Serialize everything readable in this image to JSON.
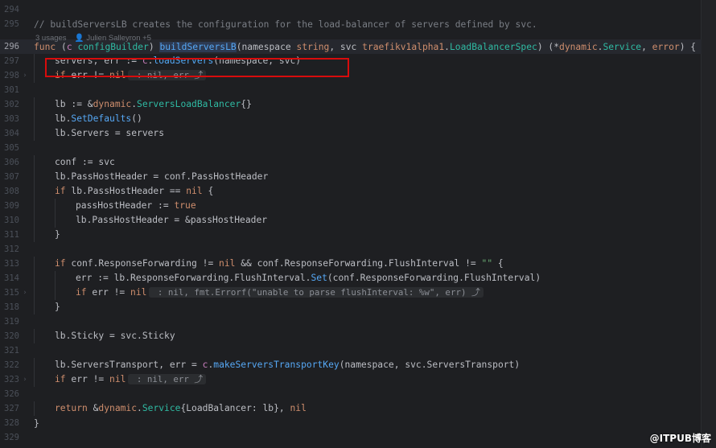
{
  "editor": {
    "usages_text": "3 usages",
    "author_text": "Julien Salleyron +5",
    "watermark": "@ITPUB博客"
  },
  "lines": [
    {
      "n": "294",
      "segments": []
    },
    {
      "n": "295",
      "segments": [
        {
          "t": "// buildServersLB creates the configuration for the load-balancer of servers defined by svc.",
          "c": "comment"
        }
      ]
    },
    {
      "n": "296",
      "current": true,
      "segments": [
        {
          "t": "func ",
          "c": "kw"
        },
        {
          "t": "(",
          "c": "plain"
        },
        {
          "t": "c ",
          "c": "param"
        },
        {
          "t": "configBuilder",
          "c": "type"
        },
        {
          "t": ") ",
          "c": "plain"
        },
        {
          "t": "buildServersLB",
          "c": "hl-fn"
        },
        {
          "t": "(namespace ",
          "c": "plain"
        },
        {
          "t": "string",
          "c": "kw"
        },
        {
          "t": ", svc ",
          "c": "plain"
        },
        {
          "t": "traefikv1alpha1",
          "c": "kw"
        },
        {
          "t": ".",
          "c": "plain"
        },
        {
          "t": "LoadBalancerSpec",
          "c": "type"
        },
        {
          "t": ") (*",
          "c": "plain"
        },
        {
          "t": "dynamic",
          "c": "kw"
        },
        {
          "t": ".",
          "c": "plain"
        },
        {
          "t": "Service",
          "c": "type"
        },
        {
          "t": ", ",
          "c": "plain"
        },
        {
          "t": "error",
          "c": "kw"
        },
        {
          "t": ") {",
          "c": "plain"
        }
      ]
    },
    {
      "n": "297",
      "indent": 1,
      "segments": [
        {
          "t": "servers, err := ",
          "c": "plain"
        },
        {
          "t": "c",
          "c": "param"
        },
        {
          "t": ".",
          "c": "plain"
        },
        {
          "t": "loadServers",
          "c": "fn"
        },
        {
          "t": "(namespace, svc)",
          "c": "plain"
        }
      ]
    },
    {
      "n": "298",
      "fold": "›",
      "indent": 1,
      "segments": [
        {
          "t": "if ",
          "c": "kw"
        },
        {
          "t": "err != ",
          "c": "plain"
        },
        {
          "t": "nil",
          "c": "kw"
        },
        {
          "t": " : nil, err ⤴",
          "c": "hint"
        }
      ]
    },
    {
      "n": "301",
      "segments": []
    },
    {
      "n": "302",
      "indent": 1,
      "segments": [
        {
          "t": "lb := &",
          "c": "plain"
        },
        {
          "t": "dynamic",
          "c": "kw"
        },
        {
          "t": ".",
          "c": "plain"
        },
        {
          "t": "ServersLoadBalancer",
          "c": "type"
        },
        {
          "t": "{}",
          "c": "plain"
        }
      ]
    },
    {
      "n": "303",
      "indent": 1,
      "segments": [
        {
          "t": "lb.",
          "c": "plain"
        },
        {
          "t": "SetDefaults",
          "c": "fn"
        },
        {
          "t": "()",
          "c": "plain"
        }
      ]
    },
    {
      "n": "304",
      "indent": 1,
      "segments": [
        {
          "t": "lb.Servers = servers",
          "c": "plain"
        }
      ]
    },
    {
      "n": "305",
      "segments": []
    },
    {
      "n": "306",
      "indent": 1,
      "segments": [
        {
          "t": "conf := svc",
          "c": "plain"
        }
      ]
    },
    {
      "n": "307",
      "indent": 1,
      "segments": [
        {
          "t": "lb.PassHostHeader = conf.PassHostHeader",
          "c": "plain"
        }
      ]
    },
    {
      "n": "308",
      "indent": 1,
      "segments": [
        {
          "t": "if ",
          "c": "kw"
        },
        {
          "t": "lb.PassHostHeader == ",
          "c": "plain"
        },
        {
          "t": "nil",
          "c": "kw"
        },
        {
          "t": " {",
          "c": "plain"
        }
      ]
    },
    {
      "n": "309",
      "indent": 2,
      "segments": [
        {
          "t": "passHostHeader := ",
          "c": "plain"
        },
        {
          "t": "true",
          "c": "kw"
        }
      ]
    },
    {
      "n": "310",
      "indent": 2,
      "segments": [
        {
          "t": "lb.PassHostHeader = &passHostHeader",
          "c": "plain"
        }
      ]
    },
    {
      "n": "311",
      "indent": 1,
      "segments": [
        {
          "t": "}",
          "c": "plain"
        }
      ]
    },
    {
      "n": "312",
      "segments": []
    },
    {
      "n": "313",
      "indent": 1,
      "segments": [
        {
          "t": "if ",
          "c": "kw"
        },
        {
          "t": "conf.ResponseForwarding != ",
          "c": "plain"
        },
        {
          "t": "nil",
          "c": "kw"
        },
        {
          "t": " && conf.ResponseForwarding.FlushInterval != ",
          "c": "plain"
        },
        {
          "t": "\"\"",
          "c": "str"
        },
        {
          "t": " {",
          "c": "plain"
        }
      ]
    },
    {
      "n": "314",
      "indent": 2,
      "segments": [
        {
          "t": "err := lb.ResponseForwarding.FlushInterval.",
          "c": "plain"
        },
        {
          "t": "Set",
          "c": "fn"
        },
        {
          "t": "(conf.ResponseForwarding.FlushInterval)",
          "c": "plain"
        }
      ]
    },
    {
      "n": "315",
      "fold": "›",
      "indent": 2,
      "segments": [
        {
          "t": "if ",
          "c": "kw"
        },
        {
          "t": "err != ",
          "c": "plain"
        },
        {
          "t": "nil",
          "c": "kw"
        },
        {
          "t": " : nil, fmt.Errorf(\"unable to parse flushInterval: %w\", err) ⤴",
          "c": "hint"
        }
      ]
    },
    {
      "n": "318",
      "indent": 1,
      "segments": [
        {
          "t": "}",
          "c": "plain"
        }
      ]
    },
    {
      "n": "319",
      "segments": []
    },
    {
      "n": "320",
      "indent": 1,
      "segments": [
        {
          "t": "lb.Sticky = svc.Sticky",
          "c": "plain"
        }
      ]
    },
    {
      "n": "321",
      "segments": []
    },
    {
      "n": "322",
      "indent": 1,
      "segments": [
        {
          "t": "lb.ServersTransport, err = ",
          "c": "plain"
        },
        {
          "t": "c",
          "c": "param"
        },
        {
          "t": ".",
          "c": "plain"
        },
        {
          "t": "makeServersTransportKey",
          "c": "fn"
        },
        {
          "t": "(namespace, svc.ServersTransport)",
          "c": "plain"
        }
      ]
    },
    {
      "n": "323",
      "fold": "›",
      "indent": 1,
      "segments": [
        {
          "t": "if ",
          "c": "kw"
        },
        {
          "t": "err != ",
          "c": "plain"
        },
        {
          "t": "nil",
          "c": "kw"
        },
        {
          "t": " : nil, err ⤴",
          "c": "hint"
        }
      ]
    },
    {
      "n": "326",
      "segments": []
    },
    {
      "n": "327",
      "indent": 1,
      "segments": [
        {
          "t": "return ",
          "c": "kw"
        },
        {
          "t": "&",
          "c": "plain"
        },
        {
          "t": "dynamic",
          "c": "kw"
        },
        {
          "t": ".",
          "c": "plain"
        },
        {
          "t": "Service",
          "c": "type"
        },
        {
          "t": "{LoadBalancer: lb}, ",
          "c": "plain"
        },
        {
          "t": "nil",
          "c": "kw"
        }
      ]
    },
    {
      "n": "328",
      "segments": [
        {
          "t": "}",
          "c": "plain"
        }
      ]
    },
    {
      "n": "329",
      "segments": []
    }
  ]
}
